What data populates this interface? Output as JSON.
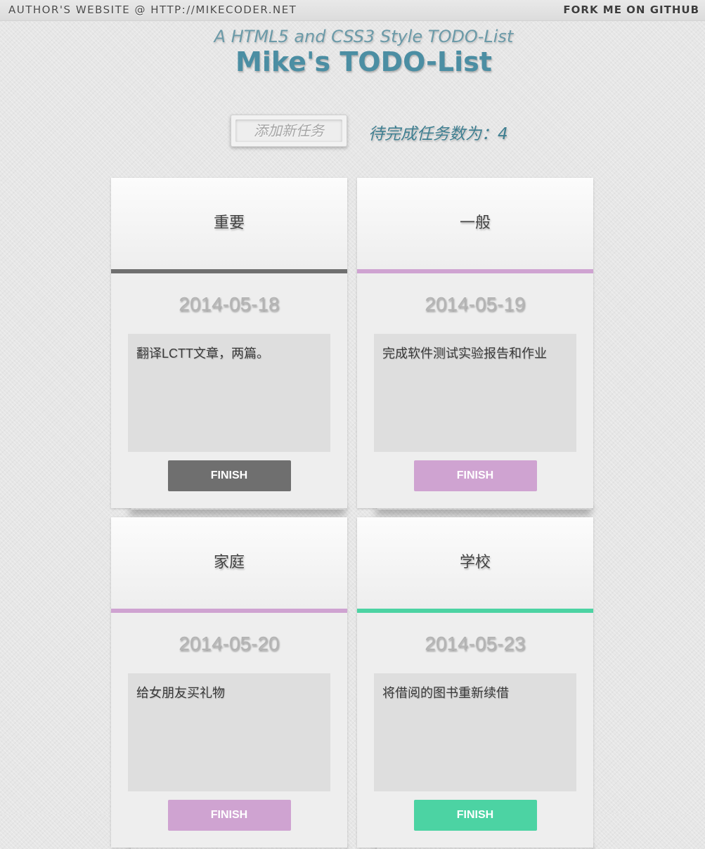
{
  "header": {
    "author_label": "AUTHOR'S WEBSITE @ HTTP://MIKECODER.NET",
    "github_label": "FORK ME ON GITHUB"
  },
  "titles": {
    "subtitle": "A HTML5 and CSS3 Style TODO-List",
    "title": "Mike's TODO-List"
  },
  "controls": {
    "add_button_label": "添加新任务",
    "counter_text": "待完成任务数为：4"
  },
  "tasks": [
    {
      "category": "重要",
      "date": "2014-05-18",
      "content": "翻译LCTT文章，两篇。",
      "finish_label": "FINISH",
      "color": "#6f6f6f"
    },
    {
      "category": "一般",
      "date": "2014-05-19",
      "content": "完成软件测试实验报告和作业",
      "finish_label": "FINISH",
      "color": "#cfa3d1"
    },
    {
      "category": "家庭",
      "date": "2014-05-20",
      "content": "给女朋友买礼物",
      "finish_label": "FINISH",
      "color": "#cfa3d1"
    },
    {
      "category": "学校",
      "date": "2014-05-23",
      "content": "将借阅的图书重新续借",
      "finish_label": "FINISH",
      "color": "#4cd3a3"
    }
  ]
}
